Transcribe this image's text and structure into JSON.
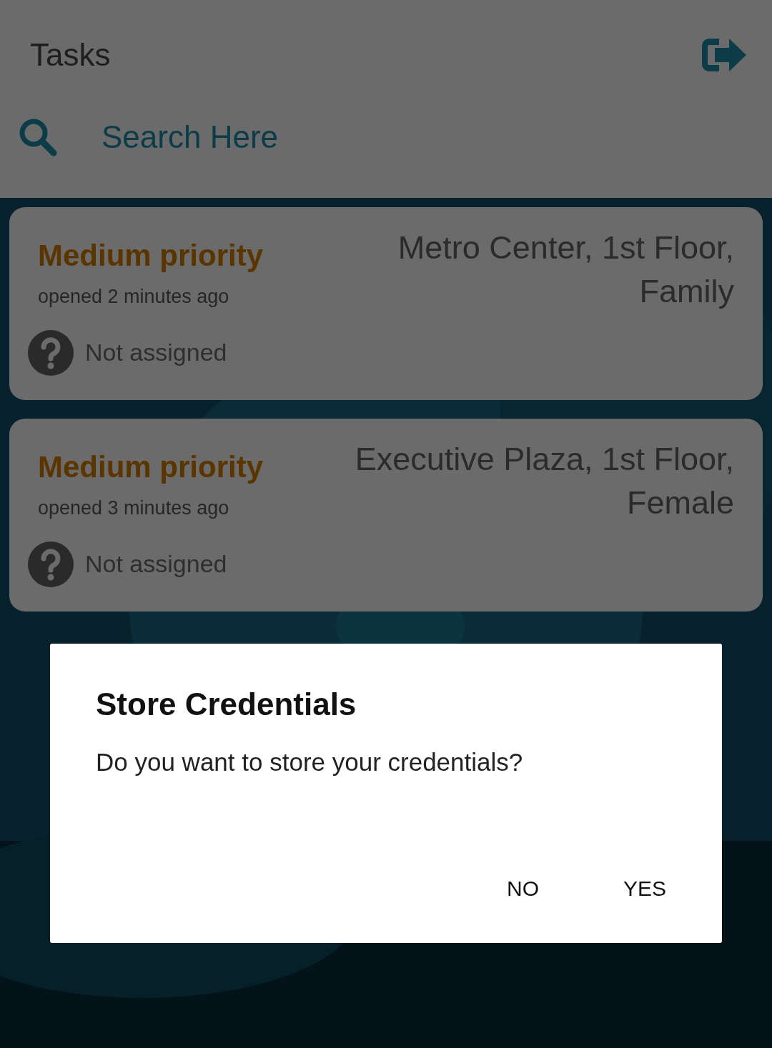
{
  "header": {
    "title": "Tasks"
  },
  "search": {
    "placeholder": "Search Here"
  },
  "tasks": [
    {
      "priority": "Medium priority",
      "opened": "opened 2 minutes ago",
      "assignee": "Not assigned",
      "location": "Metro Center, 1st Floor, Family"
    },
    {
      "priority": "Medium priority",
      "opened": "opened 3 minutes ago",
      "assignee": "Not assigned",
      "location": "Executive Plaza, 1st Floor, Female"
    }
  ],
  "dialog": {
    "title": "Store Credentials",
    "message": "Do you want to store your credentials?",
    "buttons": [
      "NO",
      "YES"
    ]
  }
}
